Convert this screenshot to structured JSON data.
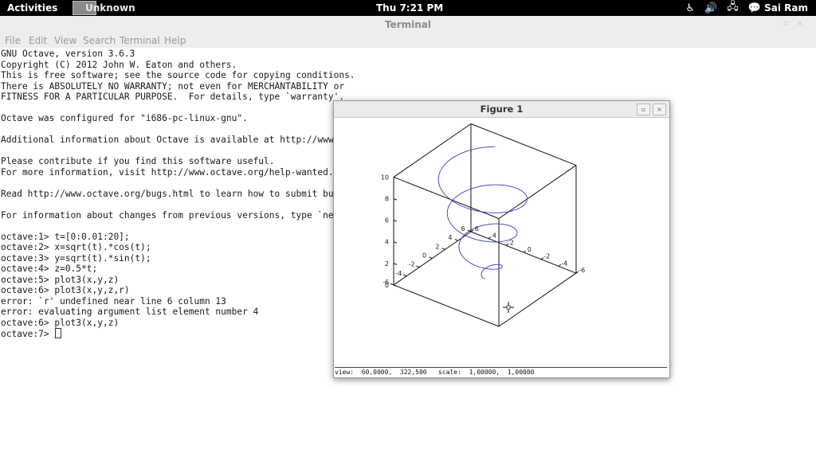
{
  "topbar": {
    "activities": "Activities",
    "app_name": "Unknown",
    "clock": "Thu  7:21 PM",
    "user": "Sai Ram",
    "tray_icons": [
      "accessibility-icon",
      "volume-icon",
      "network-icon",
      "chat-icon"
    ]
  },
  "terminal": {
    "title": "Terminal",
    "menu": [
      "File",
      "Edit",
      "View",
      "Search",
      "Terminal",
      "Help"
    ],
    "lines": [
      "GNU Octave, version 3.6.3",
      "Copyright (C) 2012 John W. Eaton and others.",
      "This is free software; see the source code for copying conditions.",
      "There is ABSOLUTELY NO WARRANTY; not even for MERCHANTABILITY or",
      "FITNESS FOR A PARTICULAR PURPOSE.  For details, type `warranty'.",
      "",
      "Octave was configured for \"i686-pc-linux-gnu\".",
      "",
      "Additional information about Octave is available at http://www",
      "",
      "Please contribute if you find this software useful.",
      "For more information, visit http://www.octave.org/help-wanted.",
      "",
      "Read http://www.octave.org/bugs.html to learn how to submit bu",
      "",
      "For information about changes from previous versions, type `ne",
      "",
      "octave:1> t=[0:0.01:20];",
      "octave:2> x=sqrt(t).*cos(t);",
      "octave:3> y=sqrt(t).*sin(t);",
      "octave:4> z=0.5*t;",
      "octave:5> plot3(x,y,z)",
      "octave:6> plot3(x,y,z,r)",
      "error: `r' undefined near line 6 column 13",
      "error: evaluating argument list element number 4",
      "octave:6> plot3(x,y,z)",
      "octave:7> "
    ]
  },
  "figure": {
    "title": "Figure 1",
    "status": "view:  60,0000,  322,500   scale:  1,00000,  1,00000",
    "max_glyph": "▫",
    "close_glyph": "×"
  },
  "chart_data": {
    "type": "line",
    "title": "",
    "series": [
      {
        "x_expr": "sqrt(t).*cos(t)",
        "y_expr": "sqrt(t).*sin(t)",
        "z_expr": "0.5*t",
        "t_range": [
          0,
          20
        ],
        "t_step": 0.01,
        "color": "#3a3acc"
      }
    ],
    "xlim": [
      -6,
      6
    ],
    "ylim": [
      -6,
      6
    ],
    "zlim": [
      0,
      10
    ],
    "x_ticks": [
      "-6",
      "-4",
      "-2",
      "0",
      "2",
      "4",
      "6"
    ],
    "y_ticks": [
      "-6",
      "-4",
      "-2",
      "0",
      "2",
      "4",
      "6"
    ],
    "z_ticks": [
      "0",
      "2",
      "4",
      "6",
      "8",
      "10"
    ],
    "view_azimuth": 60,
    "view_elevation": 322.5,
    "grid": false
  }
}
